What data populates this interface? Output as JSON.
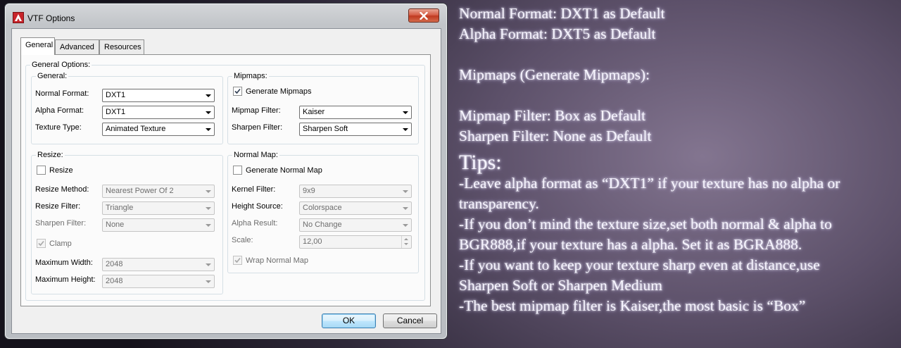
{
  "window": {
    "title": "VTF Options",
    "close_icon": "close-icon",
    "app_icon": "vtf-app-icon"
  },
  "tabs": [
    {
      "label": "General"
    },
    {
      "label": "Advanced"
    },
    {
      "label": "Resources"
    }
  ],
  "general_options": {
    "label": "General Options:",
    "general": {
      "label": "General:",
      "normal_format": {
        "label": "Normal Format:",
        "value": "DXT1"
      },
      "alpha_format": {
        "label": "Alpha Format:",
        "value": "DXT1"
      },
      "texture_type": {
        "label": "Texture Type:",
        "value": "Animated Texture"
      }
    },
    "mipmaps": {
      "label": "Mipmaps:",
      "generate": {
        "label": "Generate Mipmaps",
        "checked": true
      },
      "mipmap_filter": {
        "label": "Mipmap Filter:",
        "value": "Kaiser"
      },
      "sharpen_filter": {
        "label": "Sharpen Filter:",
        "value": "Sharpen Soft"
      }
    },
    "resize": {
      "label": "Resize:",
      "resize_check": {
        "label": "Resize",
        "checked": false
      },
      "resize_method": {
        "label": "Resize Method:",
        "value": "Nearest Power Of 2"
      },
      "resize_filter": {
        "label": "Resize Filter:",
        "value": "Triangle"
      },
      "sharpen_filter": {
        "label": "Sharpen Filter:",
        "value": "None"
      },
      "clamp": {
        "label": "Clamp",
        "checked": true
      },
      "max_width": {
        "label": "Maximum Width:",
        "value": "2048"
      },
      "max_height": {
        "label": "Maximum Height:",
        "value": "2048"
      }
    },
    "normal_map": {
      "label": "Normal Map:",
      "generate": {
        "label": "Generate Normal Map",
        "checked": false
      },
      "kernel_filter": {
        "label": "Kernel Filter:",
        "value": "9x9"
      },
      "height_source": {
        "label": "Height Source:",
        "value": "Colorspace"
      },
      "alpha_result": {
        "label": "Alpha Result:",
        "value": "No Change"
      },
      "scale": {
        "label": "Scale:",
        "value": "12,00"
      },
      "wrap": {
        "label": "Wrap Normal Map",
        "checked": true
      }
    }
  },
  "buttons": {
    "ok": "OK",
    "cancel": "Cancel"
  },
  "notes": {
    "line1": "Normal Format: DXT1 as Default",
    "line2": "Alpha Format: DXT5 as Default",
    "line3": "Mipmaps (Generate Mipmaps):",
    "line4": "Mipmap Filter: Box as Default",
    "line5": "Sharpen Filter: None as Default",
    "tips_title": "Tips:",
    "tip1a": "-Leave alpha format as “DXT1” if your texture has no alpha or",
    "tip1b": "transparency.",
    "tip2a": "-If you don’t mind the texture size,set both normal & alpha to",
    "tip2b": "BGR888,if your texture has a alpha. Set it as BGRA888.",
    "tip3a": "-If you want to keep your texture sharp even at distance,use",
    "tip3b": "Sharpen Soft or Sharpen Medium",
    "tip4": "-The best mipmap filter is Kaiser,the most basic is “Box”"
  }
}
